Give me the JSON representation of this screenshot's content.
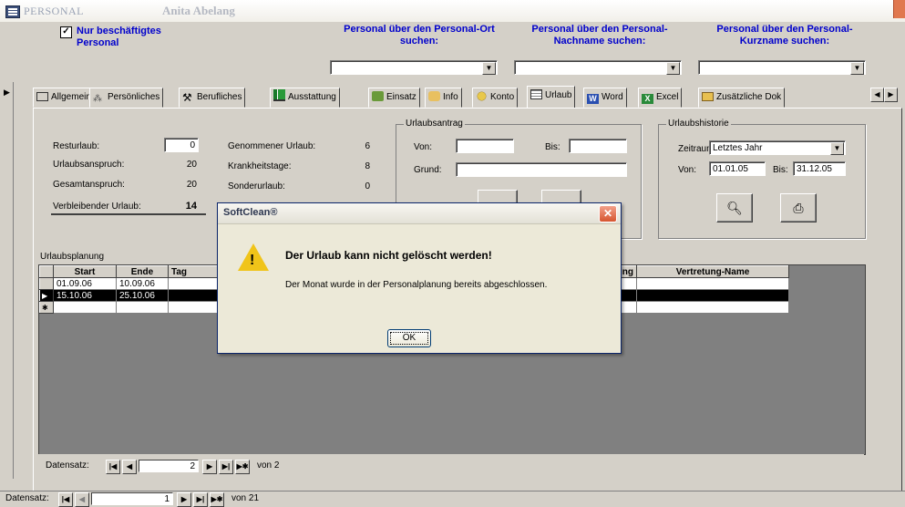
{
  "window": {
    "title_app": "PERSONAL",
    "title_name": "Anita Abelang"
  },
  "header": {
    "filter_label": "Nur beschäftigtes Personal",
    "filter_checked": "✓",
    "search_ort_label": "Personal über den Personal-Ort suchen:",
    "search_nachname_label": "Personal über den Personal-Nachname suchen:",
    "search_kurzname_label": "Personal über den Personal-Kurzname suchen:"
  },
  "tabs": [
    {
      "label": "Allgemein",
      "icon": "card-icon"
    },
    {
      "label": "Persönliches",
      "icon": "person-icon"
    },
    {
      "label": "Berufliches",
      "icon": "tools-icon"
    },
    {
      "label": "Ausstattung",
      "icon": "chart-icon"
    },
    {
      "label": "Einsatz",
      "icon": "hands-icon"
    },
    {
      "label": "Info",
      "icon": "info-icon"
    },
    {
      "label": "Konto",
      "icon": "coins-icon"
    },
    {
      "label": "Urlaub",
      "icon": "calendar-icon"
    },
    {
      "label": "Word",
      "icon": "word-icon"
    },
    {
      "label": "Excel",
      "icon": "excel-icon"
    },
    {
      "label": "Zusätzliche Dok",
      "icon": "folder-icon"
    }
  ],
  "summary": {
    "resturlaub_label": "Resturlaub:",
    "resturlaub": "0",
    "anspruch_label": "Urlaubsanspruch:",
    "anspruch": "20",
    "gesamt_label": "Gesamtanspruch:",
    "gesamt": "20",
    "verbleibend_label": "Verbleibender Urlaub:",
    "verbleibend": "14",
    "genommen_label": "Genommener Urlaub:",
    "genommen": "6",
    "krank_label": "Krankheitstage:",
    "krank": "8",
    "sonder_label": "Sonderurlaub:",
    "sonder": "0"
  },
  "antrag": {
    "caption": "Urlaubsantrag",
    "von_label": "Von:",
    "bis_label": "Bis:",
    "grund_label": "Grund:"
  },
  "historie": {
    "caption": "Urlaubshistorie",
    "zeitraum_label": "Zeitraum:",
    "zeitraum_value": "Letztes Jahr",
    "von_label": "Von:",
    "von_value": "01.01.05",
    "bis_label": "Bis:",
    "bis_value": "31.12.05"
  },
  "planung": {
    "caption": "Urlaubsplanung",
    "columns": [
      "Start",
      "Ende",
      "Tag",
      "Vertretung",
      "Vertretung-Name"
    ],
    "rows": [
      {
        "start": "01.09.06",
        "ende": "10.09.06"
      },
      {
        "start": "15.10.06",
        "ende": "25.10.06"
      }
    ],
    "new_row_marker": "✱",
    "current_row_marker": "▶"
  },
  "subnav": {
    "label": "Datensatz:",
    "current": "2",
    "total_text": "von 2"
  },
  "mainnav": {
    "label": "Datensatz:",
    "current": "1",
    "total_text": "von 21"
  },
  "dialog": {
    "title": "SoftClean®",
    "heading": "Der Urlaub kann nicht gelöscht werden!",
    "message": "Der Monat wurde in der Personalplanung bereits abgeschlossen.",
    "ok_label": "OK"
  }
}
